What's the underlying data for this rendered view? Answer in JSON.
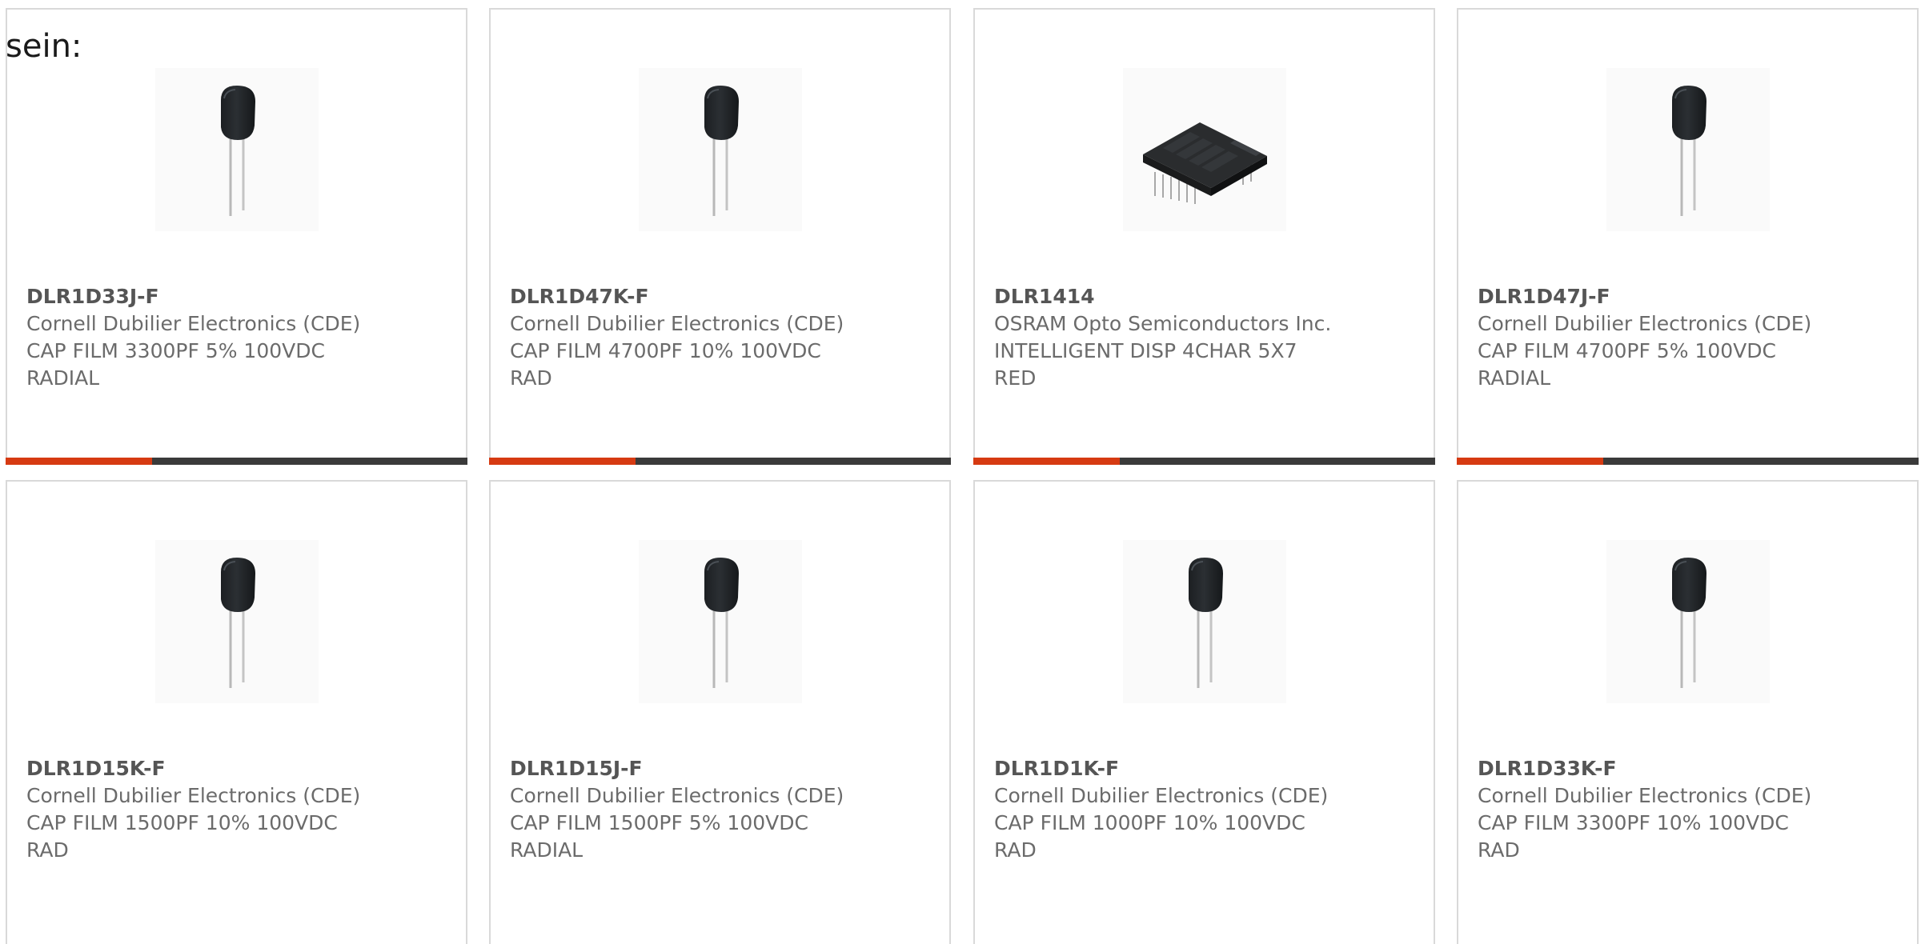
{
  "heading": "sein:",
  "products": [
    {
      "part": "DLR1D33J-F",
      "maker": "Cornell Dubilier Electronics (CDE)",
      "desc1": "CAP FILM 3300PF 5% 100VDC",
      "desc2": "RADIAL",
      "image": "film-capacitor"
    },
    {
      "part": "DLR1D47K-F",
      "maker": "Cornell Dubilier Electronics (CDE)",
      "desc1": "CAP FILM 4700PF 10% 100VDC",
      "desc2": "RAD",
      "image": "film-capacitor"
    },
    {
      "part": "DLR1414",
      "maker": "OSRAM Opto Semiconductors Inc.",
      "desc1": "INTELLIGENT DISP 4CHAR 5X7",
      "desc2": "RED",
      "image": "display-module"
    },
    {
      "part": "DLR1D47J-F",
      "maker": "Cornell Dubilier Electronics (CDE)",
      "desc1": "CAP FILM 4700PF 5% 100VDC",
      "desc2": "RADIAL",
      "image": "film-capacitor"
    },
    {
      "part": "DLR1D15K-F",
      "maker": "Cornell Dubilier Electronics (CDE)",
      "desc1": "CAP FILM 1500PF 10% 100VDC",
      "desc2": "RAD",
      "image": "film-capacitor"
    },
    {
      "part": "DLR1D15J-F",
      "maker": "Cornell Dubilier Electronics (CDE)",
      "desc1": "CAP FILM 1500PF 5% 100VDC",
      "desc2": "RADIAL",
      "image": "film-capacitor"
    },
    {
      "part": "DLR1D1K-F",
      "maker": "Cornell Dubilier Electronics (CDE)",
      "desc1": "CAP FILM 1000PF 10% 100VDC",
      "desc2": "RAD",
      "image": "film-capacitor"
    },
    {
      "part": "DLR1D33K-F",
      "maker": "Cornell Dubilier Electronics (CDE)",
      "desc1": "CAP FILM 3300PF 10% 100VDC",
      "desc2": "RAD",
      "image": "film-capacitor"
    }
  ],
  "colors": {
    "accent": "#d63a12",
    "bar": "#3a3a3a",
    "border": "#d9d9d9",
    "text": "#6b6b6b"
  }
}
